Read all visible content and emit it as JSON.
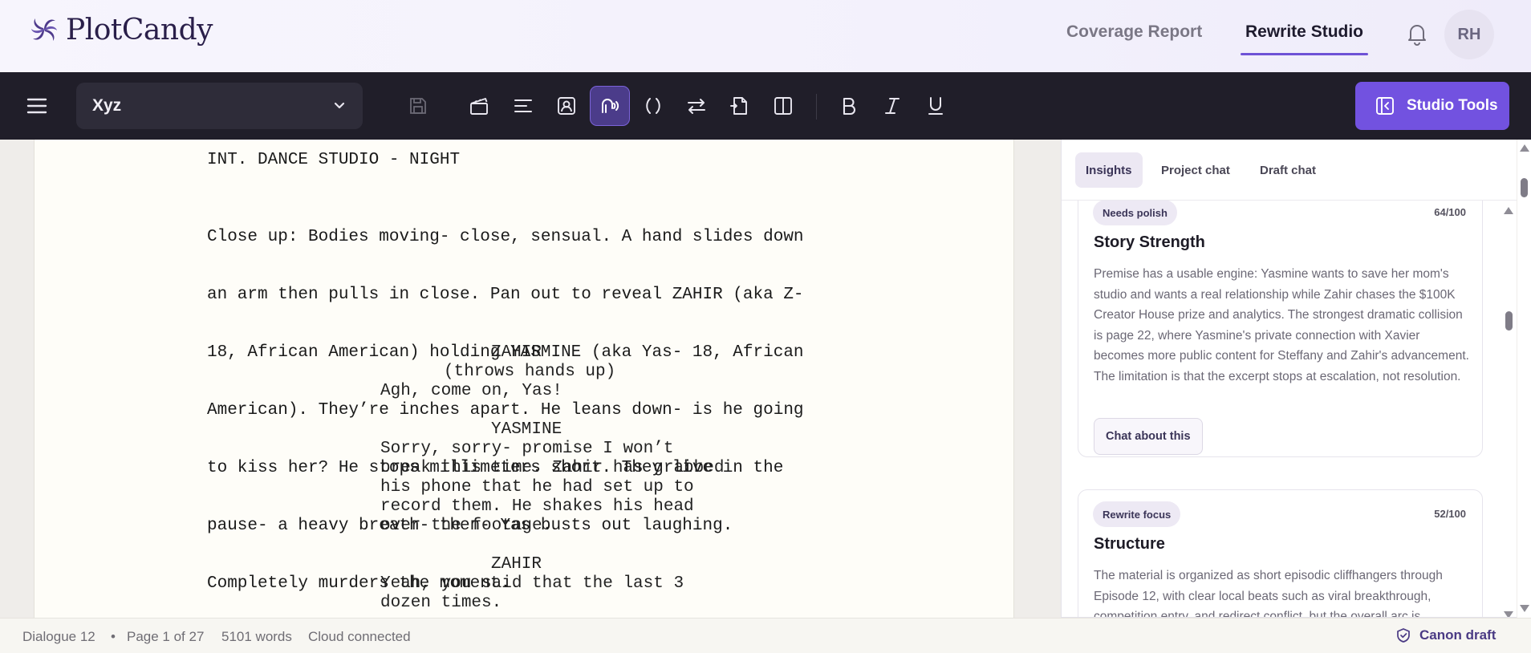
{
  "app": {
    "brand": "PlotCandy",
    "brand_accent": "#6e52d6"
  },
  "header": {
    "nav": [
      {
        "label": "Coverage Report",
        "active": false
      },
      {
        "label": "Rewrite Studio",
        "active": true
      }
    ],
    "avatar_initials": "RH"
  },
  "toolbar": {
    "document_name": "Xyz",
    "tools": [
      "save-icon",
      "scene-heading-icon",
      "action-icon",
      "character-icon",
      "dialogue-icon",
      "parenthetical-icon",
      "transition-icon",
      "page-break-icon",
      "split-view-icon",
      "bold-icon",
      "italic-icon",
      "underline-icon"
    ],
    "active_tool": "dialogue-icon",
    "studio_tools_label": "Studio Tools"
  },
  "script": {
    "scene_heading": "INT. DANCE STUDIO - NIGHT",
    "action_lines": [
      "Close up: Bodies moving- close, sensual. A hand slides down",
      "an arm then pulls in close. Pan out to reveal ZAHIR (aka Z-",
      "18, African American) holding YASMINE (aka Yas- 18, African",
      "American). They’re inches apart. He leans down- is he going",
      "to kiss her? He stops millimeters short. They live in the",
      "pause- a heavy breath- then- Yas busts out laughing.",
      "Completely murders the moment."
    ],
    "dialogue": [
      {
        "character": "ZAHIR",
        "parenthetical": "(throws hands up)",
        "lines": [
          "Agh, come on, Yas!"
        ]
      },
      {
        "character": "YASMINE",
        "parenthetical": "",
        "lines": [
          "Sorry, sorry- promise I won’t",
          "break this time. Zahir has grabbed",
          "his phone that he had set up to",
          "record them. He shakes his head",
          "over the footage."
        ]
      },
      {
        "character": "ZAHIR",
        "parenthetical": "",
        "lines": [
          "Yeah, you said that the last 3",
          "dozen times."
        ]
      }
    ]
  },
  "panel": {
    "tabs": [
      {
        "label": "Insights",
        "active": true
      },
      {
        "label": "Project chat",
        "active": false
      },
      {
        "label": "Draft chat",
        "active": false
      }
    ],
    "cards": [
      {
        "badge": "Needs polish",
        "score": "64/100",
        "title": "Story Strength",
        "body": "Premise has a usable engine: Yasmine wants to save her mom's studio and wants a real relationship while Zahir chases the $100K Creator House prize and analytics. The strongest dramatic collision is page 22, where Yasmine's private connection with Xavier becomes more public content for Steffany and Zahir's advancement. The limitation is that the excerpt stops at escalation, not resolution.",
        "action": "Chat about this"
      },
      {
        "badge": "Rewrite focus",
        "score": "52/100",
        "title": "Structure",
        "body": "The material is organized as short episodic cliffhangers through Episode 12, with clear local beats such as viral breakthrough, competition entry, and redirect conflict, but the overall arc is"
      }
    ]
  },
  "status": {
    "element": "Dialogue 12",
    "separator": "•",
    "page": "Page 1 of 27",
    "words": "5101 words",
    "connection": "Cloud connected",
    "canon_label": "Canon draft"
  }
}
